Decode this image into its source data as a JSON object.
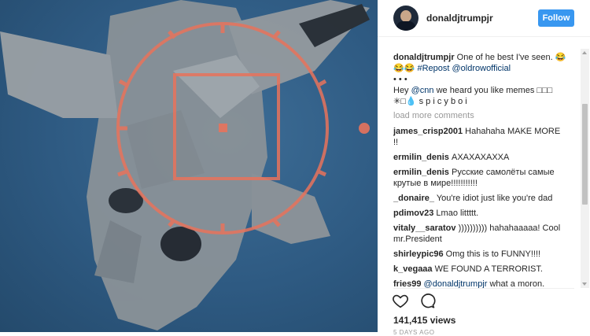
{
  "post": {
    "username": "donaldjtrumpjr",
    "follow_label": "Follow",
    "caption": {
      "user": "donaldjtrumpjr",
      "text": "One of he best I've seen. 😂😂😂",
      "tag": "#Repost @oldrowofficial",
      "dots": "• • •",
      "line2_mention": "@cnn",
      "line2_prefix": "Hey",
      "line2_rest": "we heard you like memes □□□",
      "line3": "✳︎□💧 s p i c y b o i"
    },
    "load_more": "load more comments",
    "comments": [
      {
        "user": "james_crisp2001",
        "text": "Hahahaha MAKE MORE !!"
      },
      {
        "user": "ermilin_denis",
        "text": "АХАХАХАХХА"
      },
      {
        "user": "ermilin_denis",
        "text": "Русские самолёты самые крутые в мире!!!!!!!!!!!"
      },
      {
        "user": "_donaire_",
        "text": "You're idiot just like you're dad"
      },
      {
        "user": "pdimov23",
        "text": "Lmao littttt."
      },
      {
        "user": "vitaly__saratov",
        "text": ")))))))))) hahahaaaaa! Cool mr.President"
      },
      {
        "user": "shirleypic96",
        "text": "Omg this is to FUNNY!!!!"
      },
      {
        "user": "k_vegaaa",
        "text": "WE FOUND A TERRORIST."
      },
      {
        "user": "fries99",
        "mention": "@donaldjtrumpjr",
        "text": "what a moron."
      }
    ],
    "views": "141,415 views",
    "date": "5 DAYS AGO",
    "icons": [
      "heart-icon",
      "comment-icon"
    ],
    "colors": {
      "follow": "#3897f0",
      "reticle": "#e8735c",
      "link": "#003569"
    }
  }
}
